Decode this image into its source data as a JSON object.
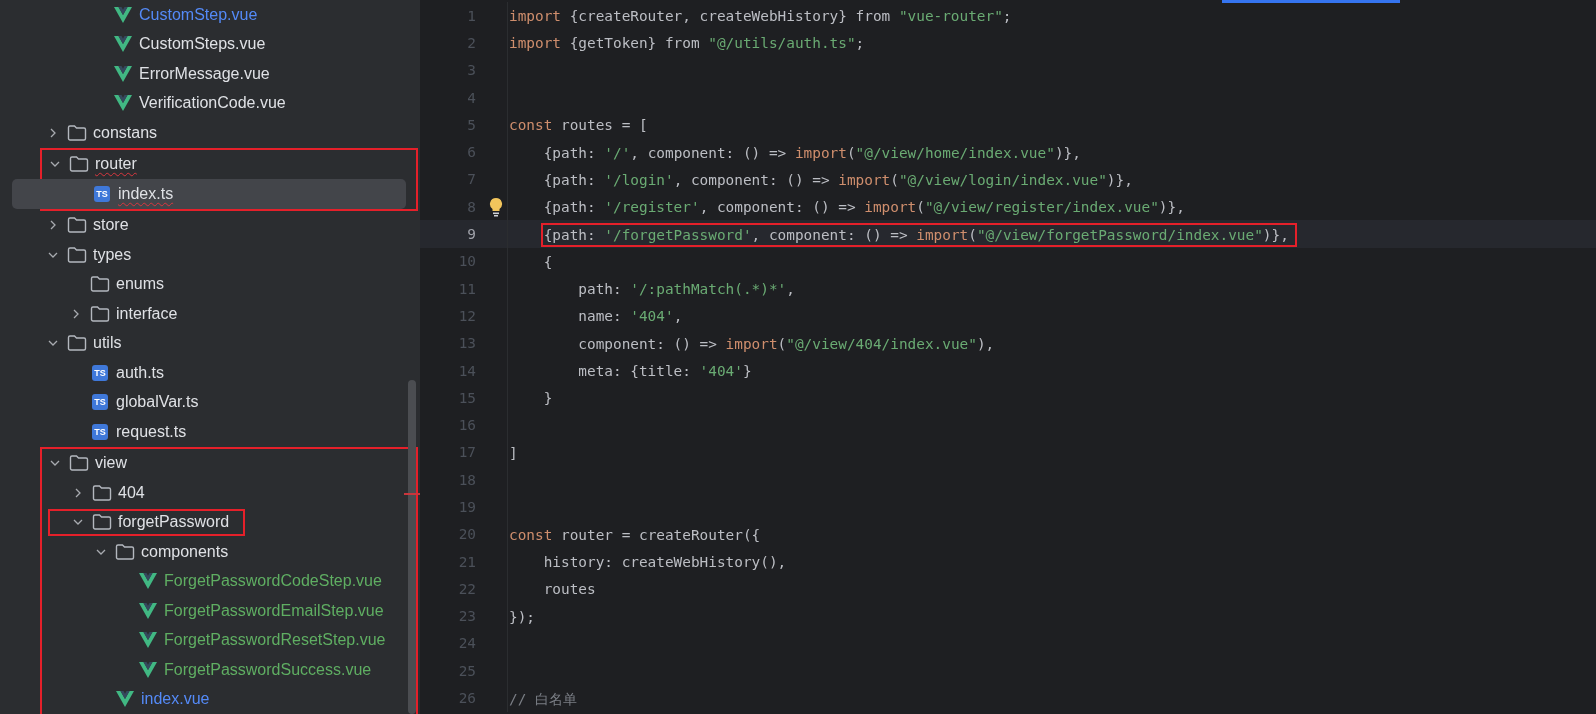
{
  "project_tree": {
    "items": [
      {
        "children": [
          {
            "children": [
              {
                "name": "CustomStep.vue",
                "kind": "vue",
                "color": "#548af7",
                "selected": false,
                "error": false,
                "framed": false
              },
              {
                "name": "CustomSteps.vue",
                "kind": "vue",
                "color": "#dfe1e5",
                "selected": false,
                "error": false,
                "framed": false
              },
              {
                "name": "ErrorMessage.vue",
                "kind": "vue",
                "color": "#dfe1e5",
                "selected": false,
                "error": false,
                "framed": false
              },
              {
                "name": "VerificationCode.vue",
                "kind": "vue",
                "color": "#dfe1e5",
                "selected": false,
                "error": false,
                "framed": false
              }
            ]
          }
        ]
      },
      {
        "name": "constans",
        "kind": "folder",
        "color": "#dfe1e5",
        "expanded": false,
        "selected": false,
        "error": false,
        "framed": false,
        "group_framed": false
      },
      {
        "name": "router",
        "kind": "folder",
        "color": "#dfe1e5",
        "expanded": true,
        "selected": false,
        "error": true,
        "framed": false,
        "group_framed": true,
        "children": [
          {
            "name": "index.ts",
            "kind": "ts",
            "icon_text": "TS",
            "color": "#dfe1e5",
            "selected": true,
            "error": true,
            "framed": false
          }
        ]
      },
      {
        "name": "store",
        "kind": "folder",
        "color": "#dfe1e5",
        "expanded": false,
        "selected": false,
        "error": false,
        "framed": false,
        "group_framed": false
      },
      {
        "name": "types",
        "kind": "folder",
        "color": "#dfe1e5",
        "expanded": true,
        "selected": false,
        "error": false,
        "framed": false,
        "group_framed": false,
        "children": [
          {
            "name": "enums",
            "kind": "folder",
            "color": "#dfe1e5",
            "selected": false,
            "error": false,
            "framed": false,
            "group_framed": false
          },
          {
            "name": "interface",
            "kind": "folder",
            "color": "#dfe1e5",
            "expanded": false,
            "selected": false,
            "error": false,
            "framed": false,
            "group_framed": false
          }
        ]
      },
      {
        "name": "utils",
        "kind": "folder",
        "color": "#dfe1e5",
        "expanded": true,
        "selected": false,
        "error": false,
        "framed": false,
        "group_framed": false,
        "children": [
          {
            "name": "auth.ts",
            "kind": "ts",
            "icon_text": "TS",
            "color": "#dfe1e5",
            "selected": false,
            "error": false,
            "framed": false
          },
          {
            "name": "globalVar.ts",
            "kind": "ts",
            "icon_text": "TS",
            "color": "#dfe1e5",
            "selected": false,
            "error": false,
            "framed": false
          },
          {
            "name": "request.ts",
            "kind": "ts",
            "icon_text": "TS",
            "color": "#dfe1e5",
            "selected": false,
            "error": false,
            "framed": false
          }
        ]
      },
      {
        "name": "view",
        "kind": "folder",
        "color": "#dfe1e5",
        "expanded": true,
        "selected": false,
        "error": false,
        "framed": false,
        "group_framed": true,
        "children": [
          {
            "name": "404",
            "kind": "folder",
            "color": "#dfe1e5",
            "expanded": false,
            "selected": false,
            "error": false,
            "framed": false,
            "group_framed": false
          },
          {
            "name": "forgetPassword",
            "kind": "folder",
            "color": "#dfe1e5",
            "expanded": true,
            "selected": false,
            "error": false,
            "framed": true,
            "group_framed": false,
            "children": [
              {
                "name": "components",
                "kind": "folder",
                "color": "#dfe1e5",
                "expanded": true,
                "selected": false,
                "error": false,
                "framed": false,
                "group_framed": false,
                "children": [
                  {
                    "name": "ForgetPasswordCodeStep.vue",
                    "kind": "vue",
                    "color": "#5fae62",
                    "selected": false,
                    "error": false,
                    "framed": false
                  },
                  {
                    "name": "ForgetPasswordEmailStep.vue",
                    "kind": "vue",
                    "color": "#5fae62",
                    "selected": false,
                    "error": false,
                    "framed": false
                  },
                  {
                    "name": "ForgetPasswordResetStep.vue",
                    "kind": "vue",
                    "color": "#5fae62",
                    "selected": false,
                    "error": false,
                    "framed": false
                  },
                  {
                    "name": "ForgetPasswordSuccess.vue",
                    "kind": "vue",
                    "color": "#5fae62",
                    "selected": false,
                    "error": false,
                    "framed": false
                  }
                ]
              },
              {
                "name": "index.vue",
                "kind": "vue",
                "color": "#548af7",
                "selected": false,
                "error": false,
                "framed": false
              }
            ]
          }
        ]
      }
    ]
  },
  "editor": {
    "lines": [
      {
        "number": "1",
        "current": false,
        "bulb": false,
        "frame": false,
        "tokens": [
          {
            "kind": "keyword",
            "text": "import"
          },
          {
            "kind": "plain",
            "text": " {createRouter, createWebHistory} from "
          },
          {
            "kind": "string",
            "text": "\"vue-router\""
          },
          {
            "kind": "plain",
            "text": ";"
          }
        ]
      },
      {
        "number": "2",
        "current": false,
        "bulb": false,
        "frame": false,
        "tokens": [
          {
            "kind": "keyword",
            "text": "import"
          },
          {
            "kind": "plain",
            "text": " {getToken} from "
          },
          {
            "kind": "string",
            "text": "\"@/utils/auth.ts\""
          },
          {
            "kind": "plain",
            "text": ";"
          }
        ]
      },
      {
        "number": "3",
        "current": false,
        "bulb": false,
        "frame": false
      },
      {
        "number": "4",
        "current": false,
        "bulb": false,
        "frame": false
      },
      {
        "number": "5",
        "current": false,
        "bulb": false,
        "frame": false,
        "tokens": [
          {
            "kind": "keyword",
            "text": "const"
          },
          {
            "kind": "plain",
            "text": " routes = ["
          }
        ]
      },
      {
        "number": "6",
        "current": false,
        "bulb": false,
        "frame": false,
        "tokens": [
          {
            "kind": "plain",
            "text": "    {path: "
          },
          {
            "kind": "string",
            "text": "'/'"
          },
          {
            "kind": "plain",
            "text": ", component: () => "
          },
          {
            "kind": "keyword",
            "text": "import"
          },
          {
            "kind": "plain",
            "text": "("
          },
          {
            "kind": "string",
            "text": "\"@/view/home/index.vue\""
          },
          {
            "kind": "plain",
            "text": ")},"
          }
        ]
      },
      {
        "number": "7",
        "current": false,
        "bulb": false,
        "frame": false,
        "tokens": [
          {
            "kind": "plain",
            "text": "    {path: "
          },
          {
            "kind": "string",
            "text": "'/login'"
          },
          {
            "kind": "plain",
            "text": ", component: () => "
          },
          {
            "kind": "keyword",
            "text": "import"
          },
          {
            "kind": "plain",
            "text": "("
          },
          {
            "kind": "string",
            "text": "\"@/view/login/index.vue\""
          },
          {
            "kind": "plain",
            "text": ")},"
          }
        ]
      },
      {
        "number": "8",
        "current": false,
        "bulb": true,
        "frame": false,
        "tokens": [
          {
            "kind": "plain",
            "text": "    {path: "
          },
          {
            "kind": "string",
            "text": "'/register'"
          },
          {
            "kind": "plain",
            "text": ", component: () => "
          },
          {
            "kind": "keyword",
            "text": "import"
          },
          {
            "kind": "plain",
            "text": "("
          },
          {
            "kind": "string",
            "text": "\"@/view/register/index.vue\""
          },
          {
            "kind": "plain",
            "text": ")},"
          }
        ]
      },
      {
        "number": "9",
        "current": true,
        "bulb": false,
        "frame": true,
        "tokens": [
          {
            "kind": "plain",
            "text": "    {path: "
          },
          {
            "kind": "string",
            "text": "'/forgetPassword'"
          },
          {
            "kind": "plain",
            "text": ", component: () => "
          },
          {
            "kind": "keyword",
            "text": "import"
          },
          {
            "kind": "plain",
            "text": "("
          },
          {
            "kind": "string",
            "text": "\"@/view/forgetPassword/index.vue\""
          },
          {
            "kind": "plain",
            "text": ")},"
          }
        ]
      },
      {
        "number": "10",
        "current": false,
        "bulb": false,
        "frame": false,
        "tokens": [
          {
            "kind": "plain",
            "text": "    {"
          }
        ]
      },
      {
        "number": "11",
        "current": false,
        "bulb": false,
        "frame": false,
        "tokens": [
          {
            "kind": "plain",
            "text": "        path: "
          },
          {
            "kind": "string",
            "text": "'/:pathMatch(.*)*'"
          },
          {
            "kind": "plain",
            "text": ","
          }
        ]
      },
      {
        "number": "12",
        "current": false,
        "bulb": false,
        "frame": false,
        "tokens": [
          {
            "kind": "plain",
            "text": "        name: "
          },
          {
            "kind": "string",
            "text": "'404'"
          },
          {
            "kind": "plain",
            "text": ","
          }
        ]
      },
      {
        "number": "13",
        "current": false,
        "bulb": false,
        "frame": false,
        "tokens": [
          {
            "kind": "plain",
            "text": "        component: () => "
          },
          {
            "kind": "keyword",
            "text": "import"
          },
          {
            "kind": "plain",
            "text": "("
          },
          {
            "kind": "string",
            "text": "\"@/view/404/index.vue\""
          },
          {
            "kind": "plain",
            "text": "),"
          }
        ]
      },
      {
        "number": "14",
        "current": false,
        "bulb": false,
        "frame": false,
        "tokens": [
          {
            "kind": "plain",
            "text": "        meta: {title: "
          },
          {
            "kind": "string",
            "text": "'404'"
          },
          {
            "kind": "plain",
            "text": "}"
          }
        ]
      },
      {
        "number": "15",
        "current": false,
        "bulb": false,
        "frame": false,
        "tokens": [
          {
            "kind": "plain",
            "text": "    }"
          }
        ]
      },
      {
        "number": "16",
        "current": false,
        "bulb": false,
        "frame": false
      },
      {
        "number": "17",
        "current": false,
        "bulb": false,
        "frame": false,
        "tokens": [
          {
            "kind": "plain",
            "text": "]"
          }
        ]
      },
      {
        "number": "18",
        "current": false,
        "bulb": false,
        "frame": false
      },
      {
        "number": "19",
        "current": false,
        "bulb": false,
        "frame": false
      },
      {
        "number": "20",
        "current": false,
        "bulb": false,
        "frame": false,
        "tokens": [
          {
            "kind": "keyword",
            "text": "const"
          },
          {
            "kind": "plain",
            "text": " router = createRouter({"
          }
        ]
      },
      {
        "number": "21",
        "current": false,
        "bulb": false,
        "frame": false,
        "tokens": [
          {
            "kind": "plain",
            "text": "    history: createWebHistory(),"
          }
        ]
      },
      {
        "number": "22",
        "current": false,
        "bulb": false,
        "frame": false,
        "tokens": [
          {
            "kind": "plain",
            "text": "    routes"
          }
        ]
      },
      {
        "number": "23",
        "current": false,
        "bulb": false,
        "frame": false,
        "tokens": [
          {
            "kind": "plain",
            "text": "});"
          }
        ]
      },
      {
        "number": "24",
        "current": false,
        "bulb": false,
        "frame": false
      },
      {
        "number": "25",
        "current": false,
        "bulb": false,
        "frame": false
      },
      {
        "number": "26",
        "current": false,
        "bulb": false,
        "frame": false,
        "tokens": [
          {
            "kind": "comment",
            "text": "// 白名单"
          }
        ]
      }
    ]
  }
}
